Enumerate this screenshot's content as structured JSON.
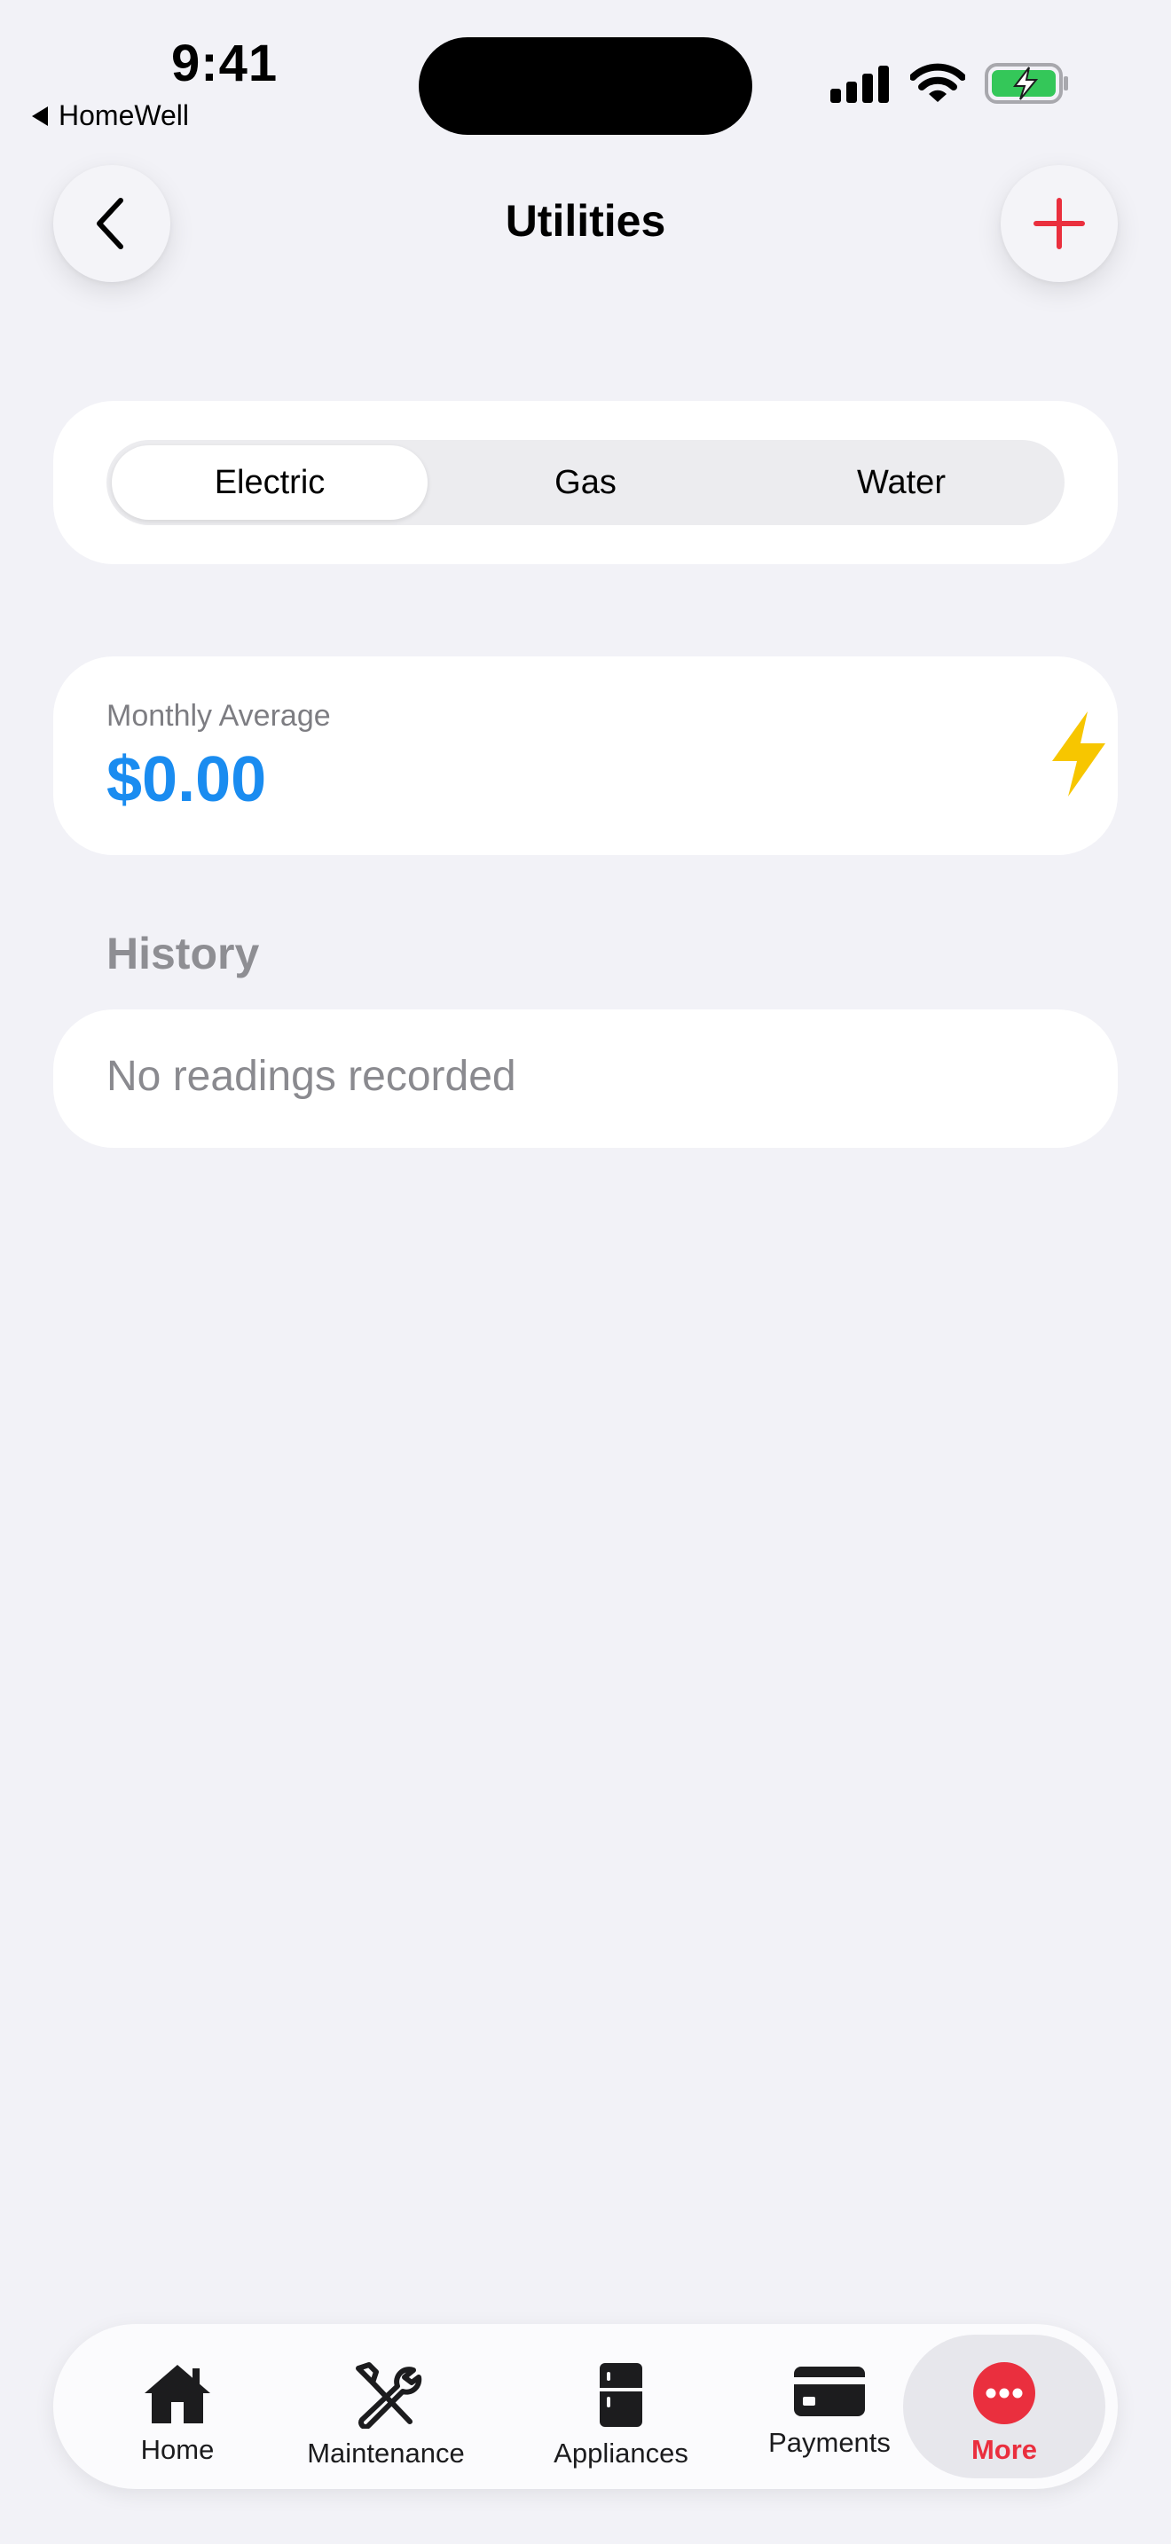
{
  "status": {
    "time": "9:41",
    "back_app": "HomeWell"
  },
  "nav": {
    "title": "Utilities"
  },
  "segments": [
    {
      "label": "Electric",
      "active": true
    },
    {
      "label": "Gas",
      "active": false
    },
    {
      "label": "Water",
      "active": false
    }
  ],
  "summary": {
    "label": "Monthly Average",
    "value": "$0.00",
    "icon": "lightning-bolt-icon"
  },
  "history": {
    "title": "History",
    "empty": "No readings recorded"
  },
  "tabs": [
    {
      "label": "Home",
      "icon": "house-icon"
    },
    {
      "label": "Maintenance",
      "icon": "wrench-screwdriver-icon"
    },
    {
      "label": "Appliances",
      "icon": "refrigerator-icon"
    },
    {
      "label": "Payments",
      "icon": "credit-card-icon"
    },
    {
      "label": "More",
      "icon": "more-icon",
      "active": true
    }
  ],
  "colors": {
    "accent_red": "#ea2f3e",
    "value_blue": "#1a8cf0",
    "bolt_yellow": "#f7c600",
    "battery_green": "#34c759"
  }
}
